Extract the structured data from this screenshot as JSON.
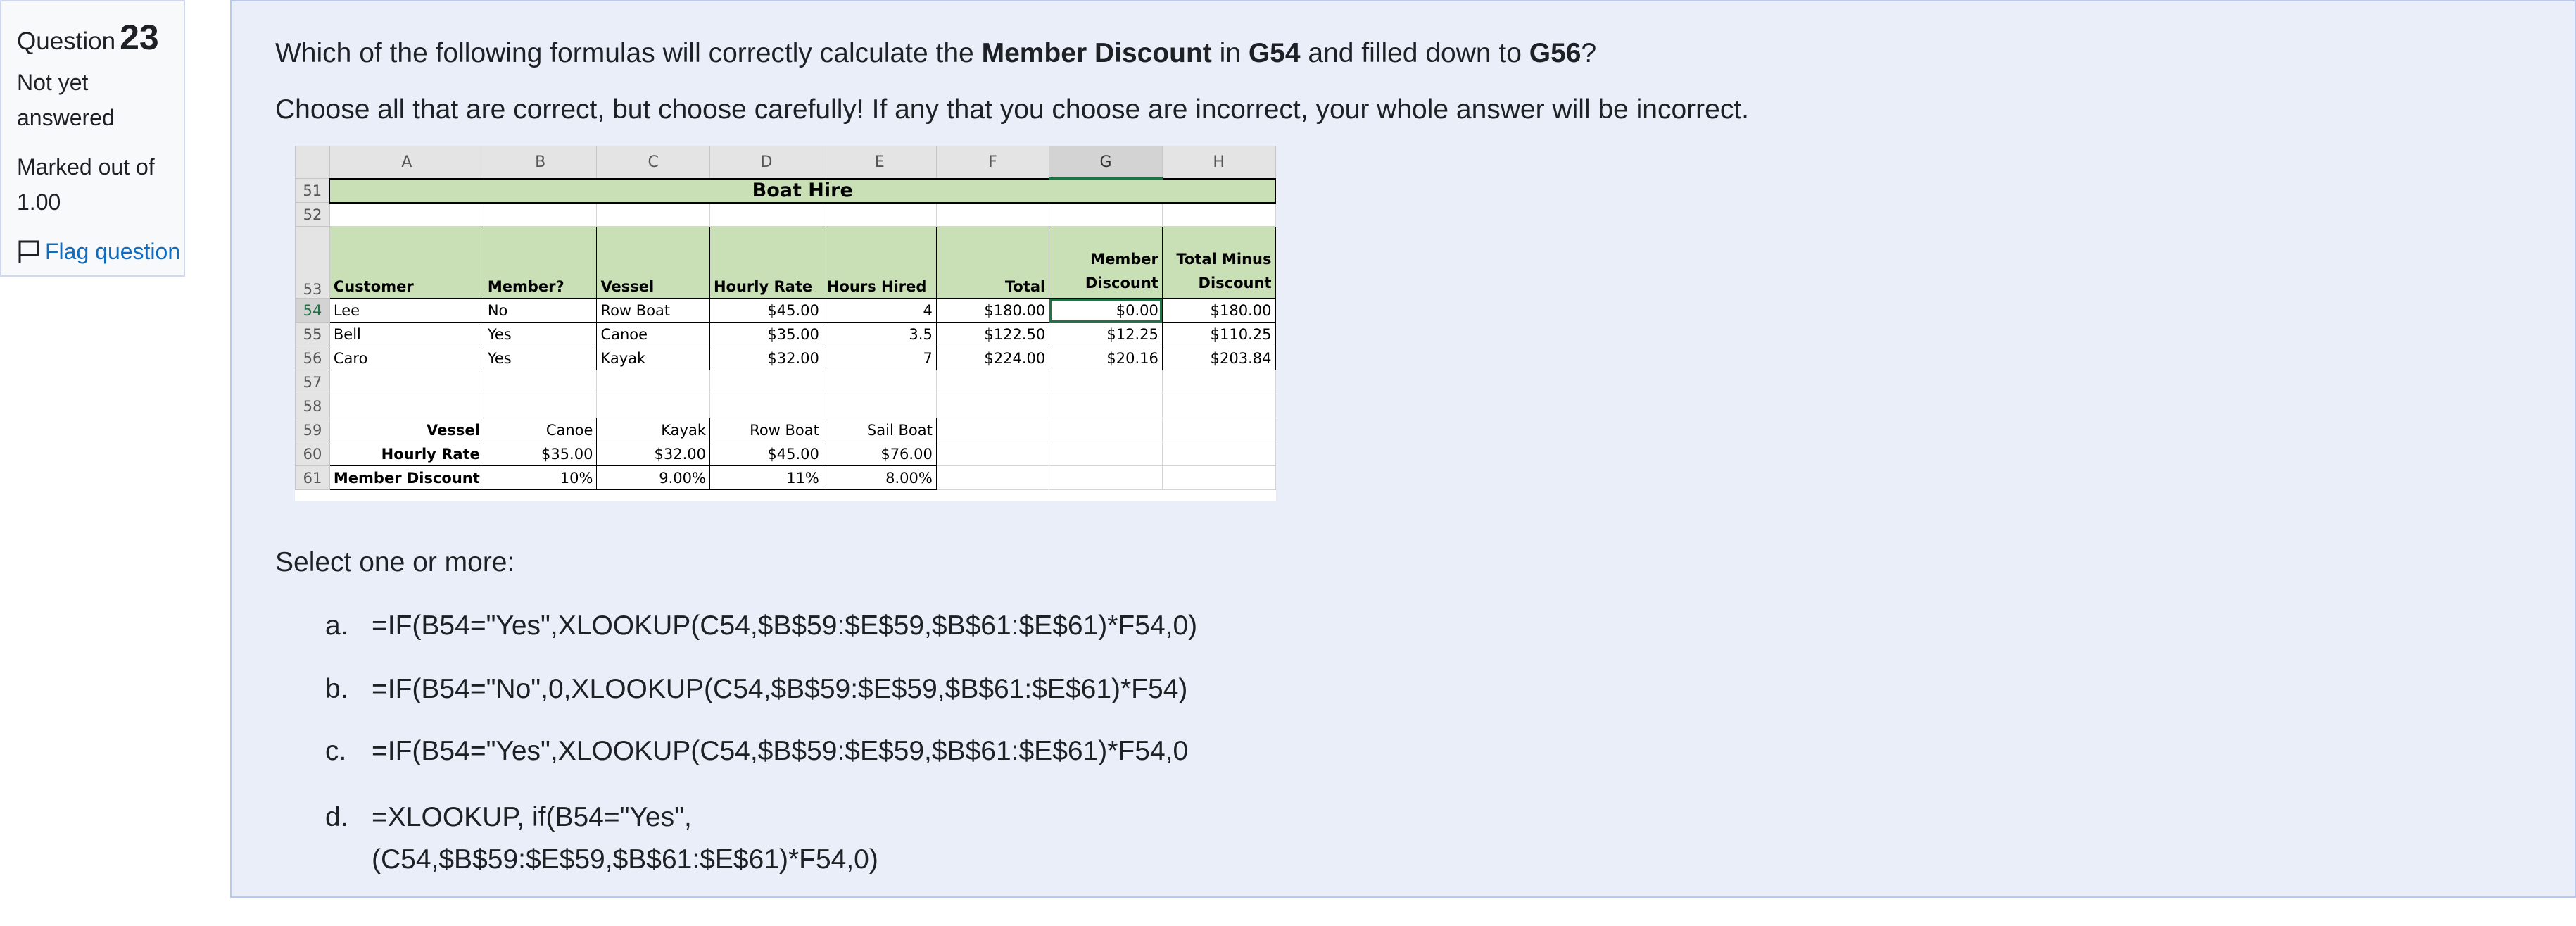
{
  "info": {
    "question_label": "Question",
    "question_number": "23",
    "state": "Not yet answered",
    "grade": "Marked out of 1.00",
    "flag_label": "Flag question"
  },
  "question": {
    "line1": {
      "p1": "Which of the following formulas will correctly calculate the ",
      "b1": "Member Discount",
      "p2": " in ",
      "b2": "G54",
      "p3": " and filled down to ",
      "b3": "G56",
      "p4": "?"
    },
    "line2": "Choose all that are correct, but choose carefully! If any that you choose are incorrect, your whole answer will be incorrect."
  },
  "sheet": {
    "columns": [
      "A",
      "B",
      "C",
      "D",
      "E",
      "F",
      "G",
      "H"
    ],
    "rows": [
      "51",
      "52",
      "53",
      "54",
      "55",
      "56",
      "57",
      "58",
      "59",
      "60",
      "61"
    ],
    "title": "Boat Hire",
    "headers": [
      "Customer",
      "Member?",
      "Vessel",
      "Hourly Rate",
      "Hours Hired",
      "Total",
      "Member Discount",
      "Total Minus Discount"
    ],
    "data": [
      [
        "Lee",
        "No",
        "Row Boat",
        "$45.00",
        "4",
        "$180.00",
        "$0.00",
        "$180.00"
      ],
      [
        "Bell",
        "Yes",
        "Canoe",
        "$35.00",
        "3.5",
        "$122.50",
        "$12.25",
        "$110.25"
      ],
      [
        "Caro",
        "Yes",
        "Kayak",
        "$32.00",
        "7",
        "$224.00",
        "$20.16",
        "$203.84"
      ]
    ],
    "lookup": [
      [
        "Vessel",
        "Canoe",
        "Kayak",
        "Row Boat",
        "Sail Boat"
      ],
      [
        "Hourly Rate",
        "$35.00",
        "$32.00",
        "$45.00",
        "$76.00"
      ],
      [
        "Member Discount",
        "10%",
        "9.00%",
        "11%",
        "8.00%"
      ]
    ]
  },
  "select_label": "Select one or more:",
  "options": [
    {
      "letter": "a.",
      "text": "=IF(B54=\"Yes\",XLOOKUP(C54,$B$59:$E$59,$B$61:$E$61)*F54,0)"
    },
    {
      "letter": "b.",
      "text": "=IF(B54=\"No\",0,XLOOKUP(C54,$B$59:$E$59,$B$61:$E$61)*F54)"
    },
    {
      "letter": "c.",
      "text": "=IF(B54=\"Yes\",XLOOKUP(C54,$B$59:$E$59,$B$61:$E$61)*F54,0"
    },
    {
      "letter": "d.",
      "text": "=XLOOKUP, if(B54=\"Yes\",",
      "text2": "(C54,$B$59:$E$59,$B$61:$E$61)*F54,0)"
    }
  ],
  "colors": {
    "accent_blue": "#0f6cbf",
    "panel_bg": "#e9eef8",
    "header_green": "#c9e0b6",
    "excel_green": "#217346"
  }
}
